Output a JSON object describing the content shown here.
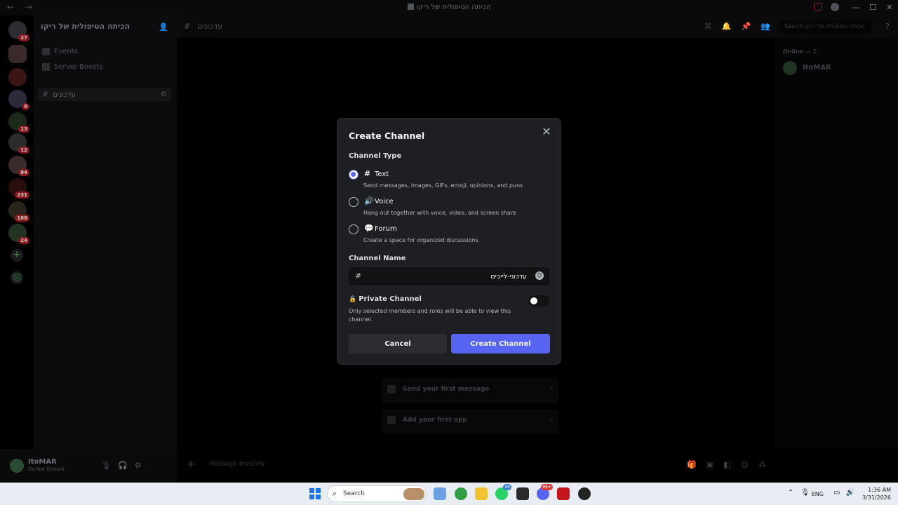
{
  "window": {
    "title": "הכיתה הטיפולית של ריקו",
    "nav_arrows": "← →"
  },
  "rail": {
    "badges": [
      "27",
      "9",
      "13",
      "12",
      "94",
      "231",
      "168",
      "24"
    ]
  },
  "sidebar": {
    "server_name": "הכיתה הטיפולית של ריקו",
    "items": [
      {
        "label": "Events"
      },
      {
        "label": "Server Boosts"
      }
    ],
    "channel": "עדכונים"
  },
  "user": {
    "name": "ItoMAR",
    "status": "Do Not Disturb"
  },
  "header": {
    "channel_name": "עדכונים",
    "search_placeholder": "Search הכיתה הטיפולית של ריקו"
  },
  "members": {
    "heading": "Online — 1",
    "member_name": "ItoMAR"
  },
  "welcome": {
    "send_first": "Send your first message",
    "add_app": "Add your first app"
  },
  "composer": {
    "placeholder": "Message #עדכונים"
  },
  "modal": {
    "title": "Create Channel",
    "type_label": "Channel Type",
    "options": [
      {
        "label": "Text",
        "desc": "Send messages, images, GIFs, emoji, opinions, and puns",
        "icon": "#",
        "selected": true
      },
      {
        "label": "Voice",
        "desc": "Hang out together with voice, video, and screen share",
        "icon": "🔊",
        "selected": false
      },
      {
        "label": "Forum",
        "desc": "Create a space for organized discussions",
        "icon": "💬",
        "selected": false
      }
    ],
    "name_label": "Channel Name",
    "name_value": "עדכוני-לייבים",
    "private_title": "Private Channel",
    "private_desc": "Only selected members and roles will be able to view this channel.",
    "cancel": "Cancel",
    "create": "Create Channel",
    "accent": "#5865f2"
  },
  "taskbar": {
    "search": "Search",
    "badges": [
      "49",
      "99+"
    ],
    "language": "ENG",
    "time": "1:36 AM",
    "date": "3/31/2026"
  }
}
